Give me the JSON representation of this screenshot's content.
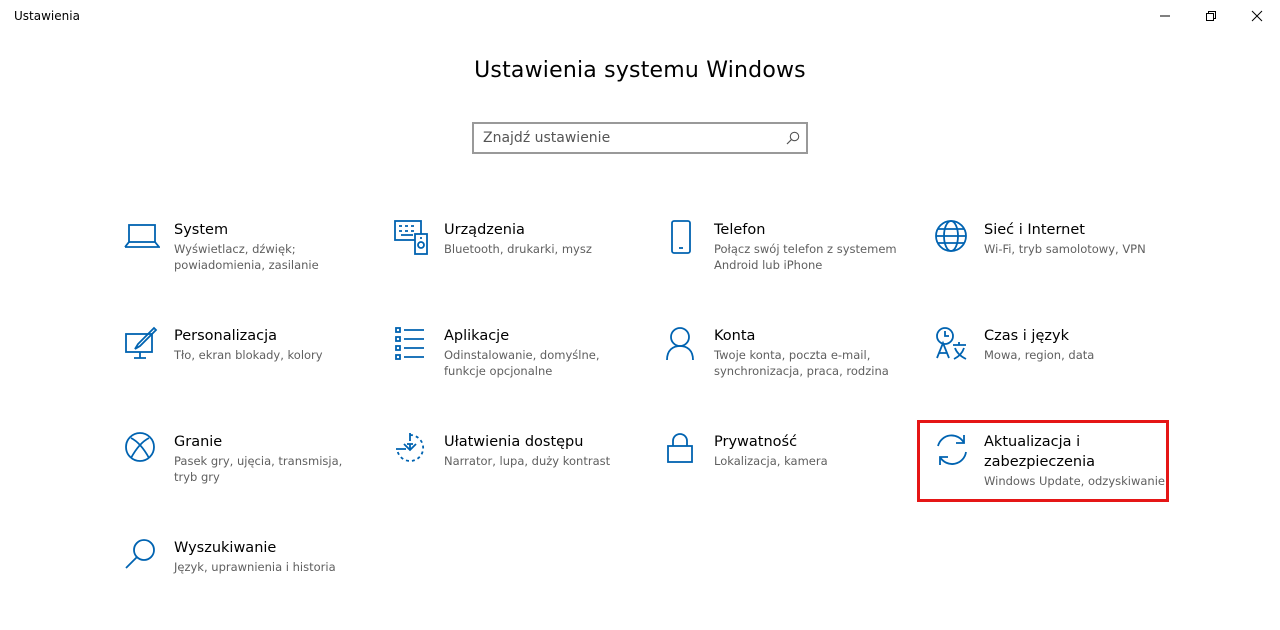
{
  "window": {
    "title": "Ustawienia",
    "controls": {
      "minimize": "minimize",
      "maximize": "restore",
      "close": "close"
    }
  },
  "header": {
    "title": "Ustawienia systemu Windows"
  },
  "search": {
    "placeholder": "Znajdź ustawienie",
    "icon": "search-icon"
  },
  "accent_color": "#0063b1",
  "highlight_color": "#e51616",
  "categories": [
    {
      "name": "System",
      "desc": "Wyświetlacz, dźwięk; powiadomienia, zasilanie",
      "icon": "laptop-icon"
    },
    {
      "name": "Urządzenia",
      "desc": "Bluetooth, drukarki, mysz",
      "icon": "devices-icon"
    },
    {
      "name": "Telefon",
      "desc": "Połącz swój telefon z systemem Android lub iPhone",
      "icon": "phone-icon"
    },
    {
      "name": "Sieć i Internet",
      "desc": "Wi-Fi, tryb samolotowy, VPN",
      "icon": "globe-icon"
    },
    {
      "name": "Personalizacja",
      "desc": "Tło, ekran blokady, kolory",
      "icon": "personalization-icon"
    },
    {
      "name": "Aplikacje",
      "desc": "Odinstalowanie, domyślne, funkcje opcjonalne",
      "icon": "apps-list-icon"
    },
    {
      "name": "Konta",
      "desc": "Twoje konta, poczta e-mail, synchronizacja, praca, rodzina",
      "icon": "person-icon"
    },
    {
      "name": "Czas i język",
      "desc": "Mowa, region, data",
      "icon": "time-language-icon"
    },
    {
      "name": "Granie",
      "desc": "Pasek gry, ujęcia, transmisja, tryb gry",
      "icon": "xbox-icon"
    },
    {
      "name": "Ułatwienia dostępu",
      "desc": "Narrator, lupa, duży kontrast",
      "icon": "ease-of-access-icon"
    },
    {
      "name": "Prywatność",
      "desc": "Lokalizacja, kamera",
      "icon": "lock-icon"
    },
    {
      "name": "Aktualizacja i zabezpieczenia",
      "desc": "Windows Update, odzyskiwanie,",
      "icon": "sync-icon",
      "highlighted": true
    },
    {
      "name": "Wyszukiwanie",
      "desc": "Język, uprawnienia i historia",
      "icon": "magnifier-icon"
    }
  ]
}
